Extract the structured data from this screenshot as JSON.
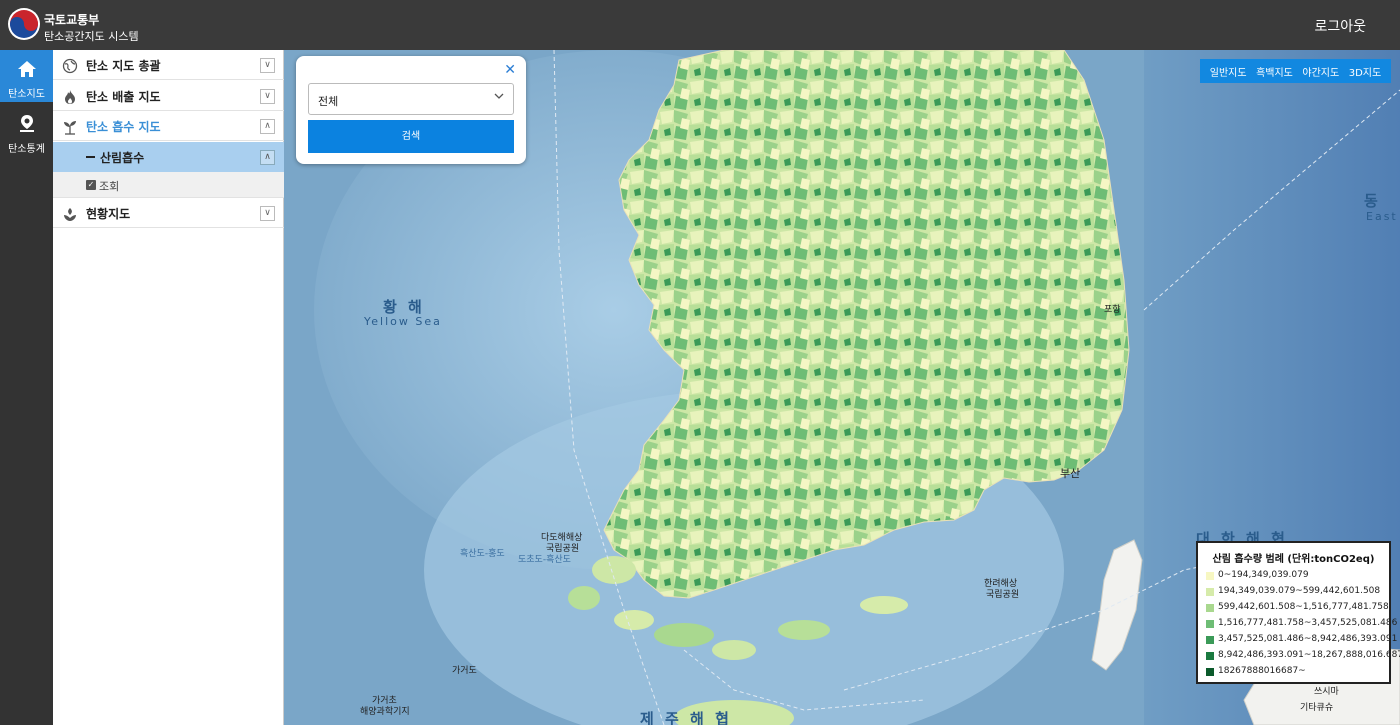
{
  "header": {
    "org_name": "국토교통부",
    "system_name": "탄소공간지도 시스템",
    "logout_label": "로그아웃"
  },
  "rail": {
    "items": [
      {
        "label": "탄소지도",
        "icon": "home-icon",
        "active": true
      },
      {
        "label": "탄소통계",
        "icon": "location-pin-icon",
        "active": false
      }
    ]
  },
  "menu": {
    "items": [
      {
        "label": "탄소 지도 총괄",
        "icon": "globe-icon",
        "open": false
      },
      {
        "label": "탄소 배출 지도",
        "icon": "flame-icon",
        "open": false
      },
      {
        "label": "탄소 흡수 지도",
        "icon": "sprout-icon",
        "open": true
      },
      {
        "label": "현황지도",
        "icon": "leaf-hand-icon",
        "open": false
      }
    ],
    "sub_item": {
      "label": "산림흡수"
    },
    "view_toggle": {
      "label": "조회",
      "checked": true
    }
  },
  "search": {
    "selected": "전체",
    "button_label": "검색"
  },
  "basemap": {
    "options": [
      "일반지도",
      "흑백지도",
      "야간지도",
      "3D지도"
    ]
  },
  "map_labels": {
    "yellow_sea_ko": "황 해",
    "yellow_sea_en": "Yellow Sea",
    "east_sea_ko": "동",
    "east_sea_en": "East",
    "korea_strait": "대 한 해 협",
    "jeju_strait": "제 주 해 협",
    "busan": "부산",
    "pohang": "포항",
    "dadohae": "다도해해상",
    "dadohae_2": "국립공원",
    "hallyeo": "한려해상",
    "hallyeo_2": "국립공원",
    "gageo": "가거도",
    "gageocho": "가거초",
    "gageocho_2": "해양과학기지",
    "tsushima": "쓰시마",
    "kitakyushu": "기타큐슈",
    "heuksando": "흑산도-홍도",
    "mokpo_heuksan": "도초도-흑산도"
  },
  "legend": {
    "title": "산림 흡수량 범례 (단위:tonCO2eq)",
    "classes": [
      {
        "label": "0~194,349,039.079",
        "color": "#f7f7c2"
      },
      {
        "label": "194,349,039.079~599,442,601.508",
        "color": "#d6ebaa"
      },
      {
        "label": "599,442,601.508~1,516,777,481.758",
        "color": "#a9d88f"
      },
      {
        "label": "1,516,777,481.758~3,457,525,081.486",
        "color": "#6ebd75"
      },
      {
        "label": "3,457,525,081.486~8,942,486,393.091",
        "color": "#3b9a58"
      },
      {
        "label": "8,942,486,393.091~18,267,888,016.687",
        "color": "#1a7a40"
      },
      {
        "label": "18267888016687~",
        "color": "#0b5a2b"
      }
    ]
  }
}
